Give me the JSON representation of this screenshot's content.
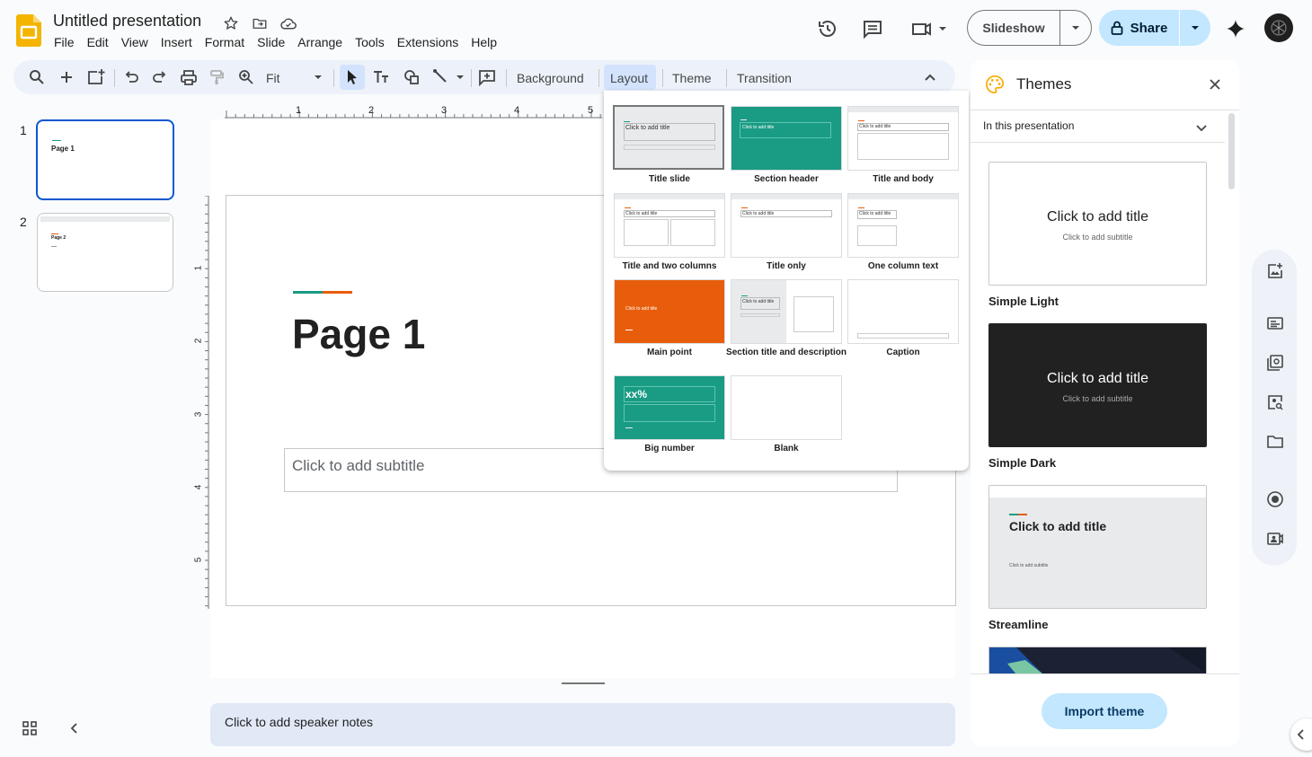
{
  "app": {
    "doc_title": "Untitled presentation",
    "menu": [
      "File",
      "Edit",
      "View",
      "Insert",
      "Format",
      "Slide",
      "Arrange",
      "Tools",
      "Extensions",
      "Help"
    ],
    "slideshow_label": "Slideshow",
    "share_label": "Share"
  },
  "toolbar": {
    "zoom_label": "Fit",
    "background_label": "Background",
    "layout_label": "Layout",
    "theme_label": "Theme",
    "transition_label": "Transition"
  },
  "slides": [
    {
      "number": "1",
      "title": "Page 1"
    },
    {
      "number": "2",
      "title": "Page 2"
    }
  ],
  "ruler": {
    "top_ticks": [
      "1",
      "2",
      "3",
      "4",
      "5"
    ],
    "left_ticks": [
      "1",
      "2",
      "3",
      "4",
      "5"
    ]
  },
  "canvas": {
    "title": "Page 1",
    "subtitle_placeholder": "Click to add subtitle",
    "notes_placeholder": "Click to add speaker notes"
  },
  "layouts": {
    "items": [
      {
        "label": "Title slide",
        "selected": true
      },
      {
        "label": "Section header"
      },
      {
        "label": "Title and body"
      },
      {
        "label": "Title and two columns"
      },
      {
        "label": "Title only"
      },
      {
        "label": "One column text"
      },
      {
        "label": "Main point"
      },
      {
        "label": "Section title and description"
      },
      {
        "label": "Caption"
      },
      {
        "label": "Big number"
      },
      {
        "label": "Blank"
      }
    ],
    "preview_title": "Click to add title",
    "big_number_text": "xx%"
  },
  "themes": {
    "title": "Themes",
    "filter": "In this presentation",
    "items": [
      {
        "name": "Simple Light",
        "title": "Click to add title",
        "subtitle": "Click to add subtitle",
        "bg": "#ffffff"
      },
      {
        "name": "Simple Dark",
        "title": "Click to add title",
        "subtitle": "Click to add subtitle",
        "bg": "#212121"
      },
      {
        "name": "Streamline",
        "title": "Click to add title",
        "subtitle": "Click to add subtitle",
        "bg": "#e8eaeb"
      }
    ],
    "import_label": "Import theme"
  },
  "colors": {
    "accent_blue": "#0b57d0",
    "share_bg": "#c2e7ff",
    "teal": "#1a9b84",
    "orange": "#e85d0c",
    "toolbar_bg": "#edf2fa"
  }
}
